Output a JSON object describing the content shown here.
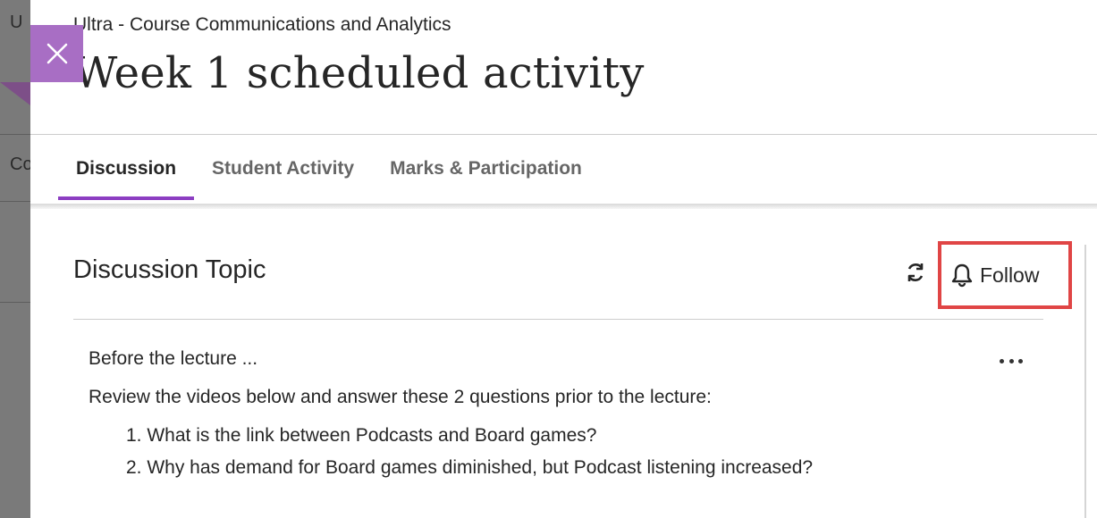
{
  "background": {
    "fragment_top": "U",
    "fragment_mid": "Co"
  },
  "header": {
    "course_name": "Ultra - Course Communications and Analytics",
    "title": "Week 1 scheduled activity"
  },
  "tabs": [
    {
      "label": "Discussion",
      "active": true
    },
    {
      "label": "Student Activity",
      "active": false
    },
    {
      "label": "Marks & Participation",
      "active": false
    }
  ],
  "topic": {
    "heading": "Discussion Topic",
    "follow_label": "Follow"
  },
  "post": {
    "intro": "Before the lecture ...",
    "instructions": "Review the videos below and answer these 2 questions prior to the lecture:",
    "questions": [
      "1. What is the link between Podcasts and Board games?",
      "2. Why has demand for Board games diminished, but Podcast listening increased?"
    ]
  },
  "colors": {
    "accent": "#8c3ec2",
    "close_bg": "#a86ec4",
    "highlight": "#e04545"
  },
  "icons": [
    "close-icon",
    "refresh-icon",
    "bell-icon",
    "more-options-icon"
  ]
}
